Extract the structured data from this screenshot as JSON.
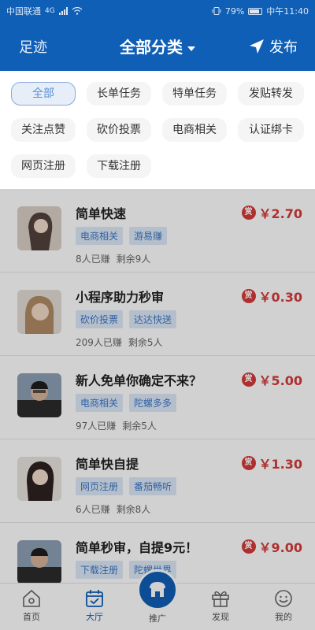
{
  "status_bar": {
    "carrier": "中国联通",
    "network": "4G",
    "battery": "79%",
    "time": "中午11:40"
  },
  "header": {
    "back_label": "足迹",
    "title": "全部分类",
    "publish_label": "发布"
  },
  "categories": [
    {
      "label": "全部",
      "active": true
    },
    {
      "label": "长单任务",
      "active": false
    },
    {
      "label": "特单任务",
      "active": false
    },
    {
      "label": "发贴转发",
      "active": false
    },
    {
      "label": "关注点赞",
      "active": false
    },
    {
      "label": "砍价投票",
      "active": false
    },
    {
      "label": "电商相关",
      "active": false
    },
    {
      "label": "认证绑卡",
      "active": false
    },
    {
      "label": "网页注册",
      "active": false
    },
    {
      "label": "下载注册",
      "active": false
    }
  ],
  "tasks": [
    {
      "title": "简单快速",
      "tags": [
        "电商相关",
        "游易赚"
      ],
      "earned": "8人已赚",
      "remaining": "剩余9人",
      "reward_icon": "赏",
      "price": "￥2.70"
    },
    {
      "title": "小程序助力秒审",
      "tags": [
        "砍价投票",
        "达达快送"
      ],
      "earned": "209人已赚",
      "remaining": "剩余5人",
      "reward_icon": "赏",
      "price": "￥0.30"
    },
    {
      "title": "新人免单你确定不来？",
      "tags": [
        "电商相关",
        "陀螺多多"
      ],
      "earned": "97人已赚",
      "remaining": "剩余5人",
      "reward_icon": "赏",
      "price": "￥5.00"
    },
    {
      "title": "简单快自提",
      "tags": [
        "网页注册",
        "番茄畅听"
      ],
      "earned": "6人已赚",
      "remaining": "剩余8人",
      "reward_icon": "赏",
      "price": "￥1.30"
    },
    {
      "title": "简单秒审，自提9元！",
      "tags": [
        "下载注册",
        "陀螺世界"
      ],
      "earned": "",
      "remaining": "",
      "reward_icon": "赏",
      "price": "￥9.00"
    }
  ],
  "tabbar": [
    {
      "label": "首页",
      "icon": "home-icon",
      "active": false
    },
    {
      "label": "大厅",
      "icon": "calendar-check-icon",
      "active": true
    },
    {
      "label": "推广",
      "icon": "shop-icon",
      "active": false
    },
    {
      "label": "发现",
      "icon": "gift-icon",
      "active": false
    },
    {
      "label": "我的",
      "icon": "smile-icon",
      "active": false
    }
  ],
  "colors": {
    "primary": "#0f5fb6",
    "price": "#d63a3a",
    "tag_bg": "#dde9f8",
    "tag_text": "#3c77c9"
  }
}
